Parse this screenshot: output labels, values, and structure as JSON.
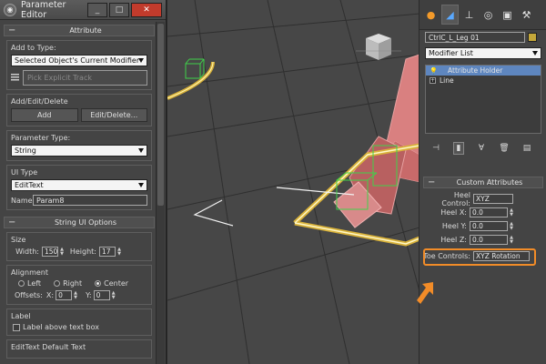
{
  "window": {
    "title": "Parameter Editor",
    "minimize": "_",
    "maximize": "□",
    "close": "✕"
  },
  "attribute": {
    "header": "Attribute",
    "add_to_type_label": "Add to Type:",
    "add_to_type_value": "Selected Object's Current Modifier",
    "pick_track_label": "Pick Explicit Track"
  },
  "add_edit_delete": {
    "label": "Add/Edit/Delete",
    "add_button": "Add",
    "edit_button": "Edit/Delete..."
  },
  "parameter_type": {
    "label": "Parameter Type:",
    "value": "String"
  },
  "ui_type": {
    "label": "UI Type",
    "value": "EditText",
    "name_label": "Name:",
    "name_value": "Param8"
  },
  "string_ui": {
    "header": "String UI Options",
    "size_label": "Size",
    "width_label": "Width:",
    "width_value": "150",
    "height_label": "Height:",
    "height_value": "17",
    "alignment_label": "Alignment",
    "left_label": "Left",
    "right_label": "Right",
    "center_label": "Center",
    "offsets_label": "Offsets:",
    "x_label": "X:",
    "x_value": "0",
    "y_label": "Y:",
    "y_value": "0",
    "label_group": "Label",
    "label_above": "Label above text box",
    "default_text_label": "EditText Default Text"
  },
  "command_panel": {
    "tabs": [
      "create-tab-icon",
      "modify-tab-icon",
      "hierarchy-tab-icon",
      "motion-tab-icon",
      "display-tab-icon",
      "utilities-tab-icon"
    ],
    "object_name": "CtrlC_L_Leg 01",
    "object_color": "#c5a83a",
    "modifier_list": "Modifier List",
    "stack": [
      "Attribute Holder",
      "Line"
    ]
  },
  "custom_attributes": {
    "header": "Custom Attributes",
    "heel_control_label": "Heel Control:",
    "heel_control_value": "XYZ",
    "heel_x_label": "Heel X:",
    "heel_x_value": "0.0",
    "heel_y_label": "Heel Y:",
    "heel_y_value": "0.0",
    "heel_z_label": "Heel Z:",
    "heel_z_value": "0.0",
    "toe_controls_label": "Toe Controls:",
    "toe_controls_value": "XYZ Rotation"
  },
  "colors": {
    "highlight": "#f28c28",
    "selection": "#5e86bf"
  }
}
